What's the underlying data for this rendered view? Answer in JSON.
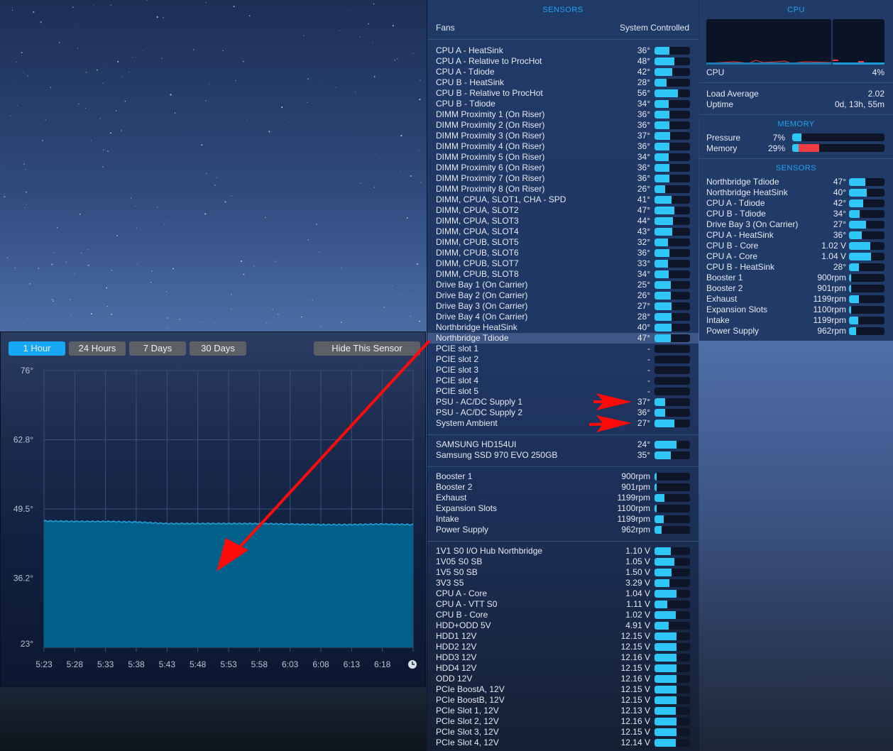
{
  "colors": {
    "accent": "#22a2f2",
    "bar": "#2fc6f8",
    "memory_red": "#ef3f45",
    "chart_fill": "#006089",
    "arrow": "#ff0a0a"
  },
  "sensors_panel": {
    "title": "SENSORS",
    "fans_label": "Fans",
    "fans_mode": "System Controlled",
    "groups": [
      [
        [
          "CPU A - HeatSink",
          "36°",
          0.42
        ],
        [
          "CPU A - Relative to ProcHot",
          "48°",
          0.56
        ],
        [
          "CPU A - Tdiode",
          "42°",
          0.49
        ],
        [
          "CPU B - HeatSink",
          "28°",
          0.33
        ],
        [
          "CPU B - Relative to ProcHot",
          "56°",
          0.66
        ],
        [
          "CPU B - Tdiode",
          "34°",
          0.4
        ],
        [
          "DIMM Proximity 1 (On Riser)",
          "36°",
          0.42
        ],
        [
          "DIMM Proximity 2 (On Riser)",
          "36°",
          0.42
        ],
        [
          "DIMM Proximity 3 (On Riser)",
          "37°",
          0.43
        ],
        [
          "DIMM Proximity 4 (On Riser)",
          "36°",
          0.42
        ],
        [
          "DIMM Proximity 5 (On Riser)",
          "34°",
          0.4
        ],
        [
          "DIMM Proximity 6 (On Riser)",
          "36°",
          0.42
        ],
        [
          "DIMM Proximity 7 (On Riser)",
          "36°",
          0.42
        ],
        [
          "DIMM Proximity 8 (On Riser)",
          "26°",
          0.3
        ],
        [
          "DIMM, CPUA, SLOT1, CHA - SPD",
          "41°",
          0.48
        ],
        [
          "DIMM, CPUA, SLOT2",
          "47°",
          0.55
        ],
        [
          "DIMM, CPUA, SLOT3",
          "44°",
          0.52
        ],
        [
          "DIMM, CPUA, SLOT4",
          "43°",
          0.5
        ],
        [
          "DIMM, CPUB, SLOT5",
          "32°",
          0.37
        ],
        [
          "DIMM, CPUB, SLOT6",
          "36°",
          0.42
        ],
        [
          "DIMM, CPUB, SLOT7",
          "33°",
          0.38
        ],
        [
          "DIMM, CPUB, SLOT8",
          "34°",
          0.4
        ],
        [
          "Drive Bay 1 (On Carrier)",
          "25°",
          0.45
        ],
        [
          "Drive Bay 2 (On Carrier)",
          "26°",
          0.46
        ],
        [
          "Drive Bay 3 (On Carrier)",
          "27°",
          0.47
        ],
        [
          "Drive Bay 4 (On Carrier)",
          "28°",
          0.48
        ],
        [
          "Northbridge HeatSink",
          "40°",
          0.47
        ],
        [
          "Northbridge Tdiode",
          "47°",
          0.45
        ],
        [
          "PCIE slot 1",
          "-",
          0
        ],
        [
          "PCIE slot 2",
          "-",
          0
        ],
        [
          "PCIE slot 3",
          "-",
          0
        ],
        [
          "PCIE slot 4",
          "-",
          0
        ],
        [
          "PCIE slot 5",
          "-",
          0
        ],
        [
          "PSU - AC/DC Supply 1",
          "37°",
          0.3
        ],
        [
          "PSU - AC/DC Supply 2",
          "36°",
          0.29
        ],
        [
          "System Ambient",
          "27°",
          0.55
        ]
      ],
      [
        [
          "SAMSUNG HD154UI",
          "24°",
          0.62
        ],
        [
          "Samsung SSD 970 EVO 250GB",
          "35°",
          0.45
        ]
      ],
      [
        [
          "Booster 1",
          "900rpm",
          0.05
        ],
        [
          "Booster 2",
          "901rpm",
          0.05
        ],
        [
          "Exhaust",
          "1199rpm",
          0.28
        ],
        [
          "Expansion Slots",
          "1100rpm",
          0.06
        ],
        [
          "Intake",
          "1199rpm",
          0.26
        ],
        [
          "Power Supply",
          "962rpm",
          0.2
        ]
      ],
      [
        [
          "1V1 S0 I/O Hub Northbridge",
          "1.10 V",
          0.45
        ],
        [
          "1V05 S0 SB",
          "1.05 V",
          0.55
        ],
        [
          "1V5 S0 SB",
          "1.50 V",
          0.48
        ],
        [
          "3V3 S5",
          "3.29 V",
          0.42
        ],
        [
          "CPU A - Core",
          "1.04 V",
          0.62
        ],
        [
          "CPU A - VTT S0",
          "1.11 V",
          0.35
        ],
        [
          "CPU B - Core",
          "1.02 V",
          0.6
        ],
        [
          "HDD+ODD 5V",
          "4.91 V",
          0.4
        ],
        [
          "HDD1 12V",
          "12.15 V",
          0.62
        ],
        [
          "HDD2 12V",
          "12.15 V",
          0.62
        ],
        [
          "HDD3 12V",
          "12.16 V",
          0.62
        ],
        [
          "HDD4 12V",
          "12.15 V",
          0.62
        ],
        [
          "ODD 12V",
          "12.16 V",
          0.62
        ],
        [
          "PCIe BoostA, 12V",
          "12.15 V",
          0.62
        ],
        [
          "PCIe BoostB, 12V",
          "12.15 V",
          0.62
        ],
        [
          "PCIe Slot 1, 12V",
          "12.13 V",
          0.6
        ],
        [
          "PCIe Slot 2, 12V",
          "12.16 V",
          0.62
        ],
        [
          "PCIe Slot 3, 12V",
          "12.15 V",
          0.62
        ],
        [
          "PCIe Slot 4, 12V",
          "12.14 V",
          0.6
        ]
      ]
    ],
    "highlighted": "Northbridge Tdiode"
  },
  "right_panel": {
    "cpu_title": "CPU",
    "cpu_label": "CPU",
    "cpu_value": "4%",
    "load_label": "Load Average",
    "load_value": "2.02",
    "uptime_label": "Uptime",
    "uptime_value": "0d, 13h, 55m",
    "memory_title": "MEMORY",
    "pressure_label": "Pressure",
    "pressure_value": "7%",
    "pressure_fill": 0.07,
    "memory_label": "Memory",
    "memory_value": "29%",
    "memory_fill_blue": 0.07,
    "memory_fill_red": 0.22,
    "sensors_title": "SENSORS",
    "sensors": [
      [
        "Northbridge Tdiode",
        "47°",
        0.45
      ],
      [
        "Northbridge HeatSink",
        "40°",
        0.5
      ],
      [
        "CPU A - Tdiode",
        "42°",
        0.4
      ],
      [
        "CPU B - Tdiode",
        "34°",
        0.3
      ],
      [
        "Drive Bay 3 (On Carrier)",
        "27°",
        0.48
      ],
      [
        "CPU A - HeatSink",
        "36°",
        0.35
      ],
      [
        "CPU B - Core",
        "1.02 V",
        0.6
      ],
      [
        "CPU A - Core",
        "1.04 V",
        0.62
      ],
      [
        "CPU B - HeatSink",
        "28°",
        0.27
      ],
      [
        "Booster 1",
        "900rpm",
        0.05
      ],
      [
        "Booster 2",
        "901rpm",
        0.05
      ],
      [
        "Exhaust",
        "1199rpm",
        0.28
      ],
      [
        "Expansion Slots",
        "1100rpm",
        0.06
      ],
      [
        "Intake",
        "1199rpm",
        0.26
      ],
      [
        "Power Supply",
        "962rpm",
        0.2
      ]
    ]
  },
  "chart_window": {
    "buttons": [
      "1 Hour",
      "24 Hours",
      "7 Days",
      "30 Days"
    ],
    "active": "1 Hour",
    "hide_button": "Hide This Sensor",
    "clock_icon": "clock-icon"
  },
  "chart_data": {
    "type": "area",
    "yticks": [
      "76°",
      "62.8°",
      "49.5°",
      "36.2°",
      "23°"
    ],
    "ylim": [
      23,
      76
    ],
    "xticks": [
      "5:23",
      "5:28",
      "5:33",
      "5:38",
      "5:43",
      "5:48",
      "5:53",
      "5:58",
      "6:03",
      "6:08",
      "6:13",
      "6:18"
    ],
    "grid": true,
    "x": [
      "5:23",
      "5:28",
      "5:33",
      "5:38",
      "5:43",
      "5:48",
      "5:53",
      "5:58",
      "6:03",
      "6:08",
      "6:13",
      "6:18",
      "6:23"
    ],
    "values": [
      47.2,
      47.1,
      47.1,
      47.0,
      46.7,
      46.7,
      46.7,
      46.7,
      46.6,
      46.5,
      46.5,
      46.6,
      46.5
    ]
  }
}
